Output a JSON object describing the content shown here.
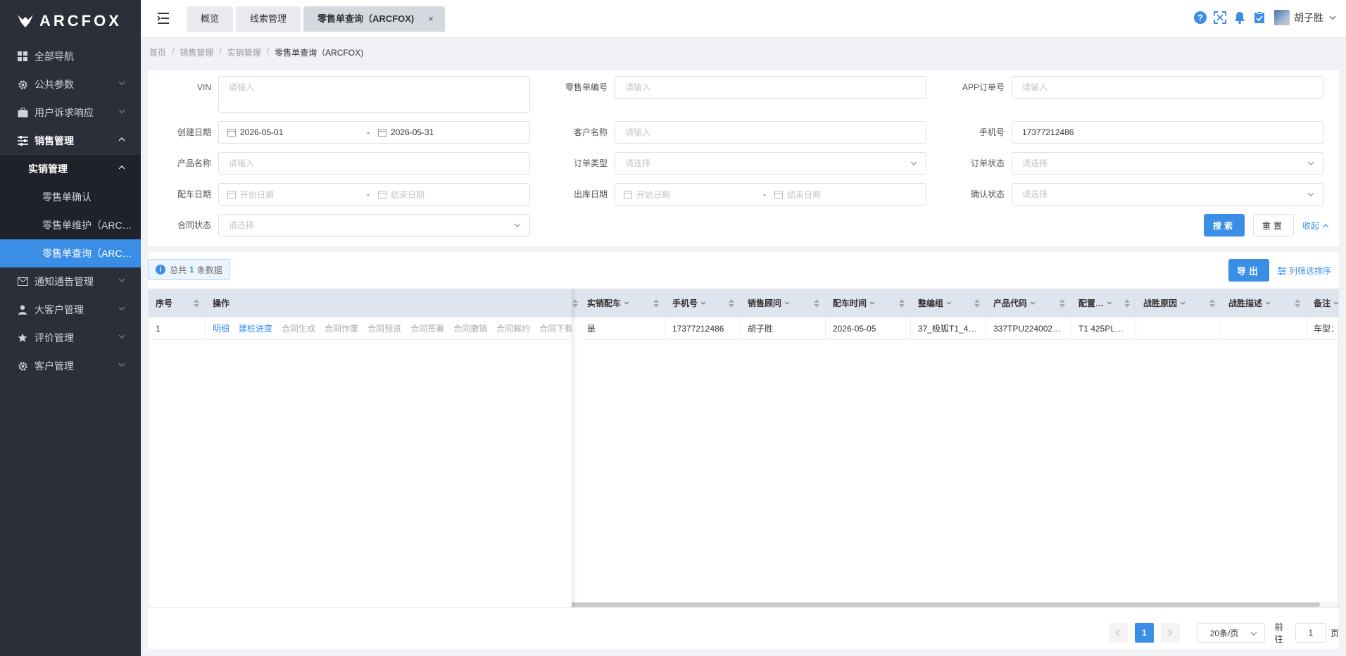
{
  "brand": {
    "name": "ARCFOX"
  },
  "sidebar": {
    "items": [
      {
        "label": "全部导航"
      },
      {
        "label": "公共参数"
      },
      {
        "label": "用户诉求响应"
      },
      {
        "label": "销售管理"
      },
      {
        "label": "实销管理"
      },
      {
        "label": "零售单确认"
      },
      {
        "label": "零售单维护（ARC…"
      },
      {
        "label": "零售单查询（ARC…"
      },
      {
        "label": "通知通告管理"
      },
      {
        "label": "大客户管理"
      },
      {
        "label": "评价管理"
      },
      {
        "label": "客户管理"
      }
    ]
  },
  "header": {
    "tabs": [
      {
        "label": "概览"
      },
      {
        "label": "线索管理"
      },
      {
        "label": "零售单查询（ARCFOX)"
      }
    ],
    "tab_close": "×",
    "username": "胡子胜"
  },
  "breadcrumb": [
    "首页",
    "销售管理",
    "实销管理",
    "零售单查询（ARCFOX)"
  ],
  "breadcrumb_sep": "/",
  "filters": {
    "vin": {
      "label": "VIN",
      "placeholder": "请输入"
    },
    "retail_no": {
      "label": "零售单编号",
      "placeholder": "请输入"
    },
    "app_order": {
      "label": "APP订单号",
      "placeholder": "请输入"
    },
    "create_date": {
      "label": "创建日期",
      "start": "2026-05-01",
      "end": "2026-05-31"
    },
    "customer_name": {
      "label": "客户名称",
      "placeholder": "请输入"
    },
    "phone": {
      "label": "手机号",
      "value": "17377212486"
    },
    "product_name": {
      "label": "产品名称",
      "placeholder": "请输入"
    },
    "order_type": {
      "label": "订单类型",
      "placeholder": "请选择"
    },
    "order_status": {
      "label": "订单状态",
      "placeholder": "请选择"
    },
    "match_date": {
      "label": "配车日期",
      "start_ph": "开始日期",
      "end_ph": "结束日期"
    },
    "out_date": {
      "label": "出库日期",
      "start_ph": "开始日期",
      "end_ph": "结束日期"
    },
    "confirm_status": {
      "label": "确认状态",
      "placeholder": "请选择"
    },
    "contract_status": {
      "label": "合同状态",
      "placeholder": "请选择"
    },
    "range_dash": "-"
  },
  "actions": {
    "search": "搜索",
    "reset": "重置",
    "collapse": "收起",
    "export": "导出",
    "column_filter": "列筛选排序"
  },
  "summary": {
    "prefix": "总共",
    "count": "1",
    "suffix": "条数据"
  },
  "table": {
    "fixed_headers": [
      "序号",
      "操作"
    ],
    "headers": [
      "实销配车",
      "手机号",
      "销售顾问",
      "配车时间",
      "整编组",
      "产品代码",
      "配置…",
      "战胜原因",
      "战胜描述",
      "备注"
    ],
    "rows": [
      {
        "index": "1",
        "ops": [
          "明细",
          "建桩进度",
          "合同生成",
          "合同作废",
          "合同预览",
          "合同签署",
          "合同撤销",
          "合同解约",
          "合同下载"
        ],
        "cells": [
          "是",
          "17377212486",
          "胡子胜",
          "2026-05-05",
          "37_极狐T1_4…",
          "337TPU224002…",
          "T1 425PL…",
          "",
          "",
          "车型："
        ]
      }
    ]
  },
  "pagination": {
    "current": "1",
    "page_size": "20条/页",
    "goto_prefix": "前往",
    "goto_value": "1",
    "goto_suffix": "页"
  },
  "colors": {
    "primary": "#3a8ee6",
    "sidebar_bg": "#2b2f3a"
  }
}
